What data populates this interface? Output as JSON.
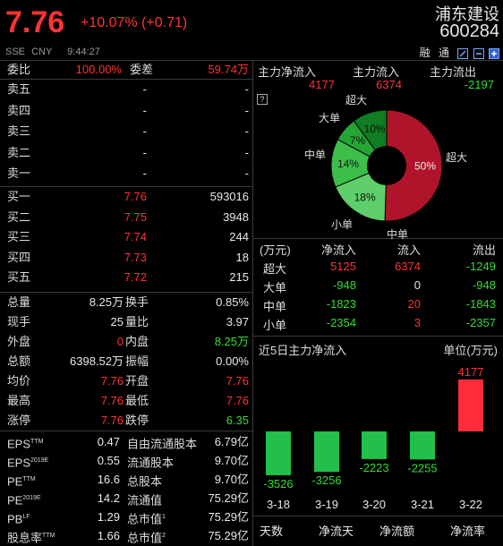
{
  "header": {
    "price": "7.76",
    "change": "+10.07% (+0.71)",
    "exchange": "SSE",
    "currency": "CNY",
    "time": "9:44:27",
    "stock_name": "浦东建设",
    "stock_code": "600284",
    "margin_label": "融",
    "through_label": "通"
  },
  "order_book": {
    "weibi_label": "委比",
    "weibi_value": "100.00%",
    "weicha_label": "委差",
    "weicha_value": "59.74万",
    "asks": [
      {
        "label": "卖五",
        "price": "-",
        "volume": "-"
      },
      {
        "label": "卖四",
        "price": "-",
        "volume": "-"
      },
      {
        "label": "卖三",
        "price": "-",
        "volume": "-"
      },
      {
        "label": "卖二",
        "price": "-",
        "volume": "-"
      },
      {
        "label": "卖一",
        "price": "-",
        "volume": "-"
      }
    ],
    "bids": [
      {
        "label": "买一",
        "price": "7.76",
        "volume": "593016"
      },
      {
        "label": "买二",
        "price": "7.75",
        "volume": "3948"
      },
      {
        "label": "买三",
        "price": "7.74",
        "volume": "244"
      },
      {
        "label": "买四",
        "price": "7.73",
        "volume": "18"
      },
      {
        "label": "买五",
        "price": "7.72",
        "volume": "215"
      }
    ]
  },
  "stats": [
    {
      "l1": "总量",
      "v1": "8.25万",
      "l2": "换手",
      "v2": "0.85%",
      "c1": "white",
      "c2": "white"
    },
    {
      "l1": "现手",
      "v1": "25",
      "l2": "量比",
      "v2": "3.97",
      "c1": "white",
      "c2": "white"
    },
    {
      "l1": "外盘",
      "v1": "0",
      "l2": "内盘",
      "v2": "8.25万",
      "c1": "red",
      "c2": "green"
    },
    {
      "l1": "总额",
      "v1": "6398.52万",
      "l2": "振幅",
      "v2": "0.00%",
      "c1": "white",
      "c2": "white"
    },
    {
      "l1": "均价",
      "v1": "7.76",
      "l2": "开盘",
      "v2": "7.76",
      "c1": "red",
      "c2": "red"
    },
    {
      "l1": "最高",
      "v1": "7.76",
      "l2": "最低",
      "v2": "7.76",
      "c1": "red",
      "c2": "red"
    },
    {
      "l1": "涨停",
      "v1": "7.76",
      "l2": "跌停",
      "v2": "6.35",
      "c1": "red",
      "c2": "green"
    }
  ],
  "fundamentals": [
    {
      "l1": "EPS",
      "s1": "TTM",
      "v1": "0.47",
      "l2": "自由流通股本",
      "s2": "",
      "v2": "6.79亿"
    },
    {
      "l1": "EPS",
      "s1": "2019E",
      "v1": "0.55",
      "l2": "流通股本",
      "s2": "",
      "v2": "9.70亿"
    },
    {
      "l1": "PE",
      "s1": "TTM",
      "v1": "16.6",
      "l2": "总股本",
      "s2": "",
      "v2": "9.70亿"
    },
    {
      "l1": "PE",
      "s1": "2019E",
      "v1": "14.2",
      "l2": "流通值",
      "s2": "",
      "v2": "75.29亿"
    },
    {
      "l1": "PB",
      "s1": "LF",
      "v1": "1.29",
      "l2": "总市值",
      "s2": "1",
      "v2": "75.29亿"
    },
    {
      "l1": "股息率",
      "s1": "TTM",
      "v1": "1.66",
      "l2": "总市值",
      "s2": "2",
      "v2": "75.29亿"
    }
  ],
  "capital_flow": {
    "net_in_label": "主力净流入",
    "in_label": "主力流入",
    "out_label": "主力流出",
    "net_in_value": "4177",
    "in_value": "6374",
    "out_value": "-2197",
    "help_label": "?"
  },
  "pie": {
    "labels": {
      "super": "超大",
      "large": "大单",
      "medium": "中单",
      "small": "小单"
    },
    "slices": [
      {
        "name": "超大",
        "pct": 50,
        "label": "50%",
        "color": "#b0142a"
      },
      {
        "name": "小单",
        "pct": 18,
        "label": "18%",
        "color": "#5ecf6a"
      },
      {
        "name": "中单",
        "pct": 14,
        "label": "14%",
        "color": "#3cbf4a"
      },
      {
        "name": "大单",
        "pct": 7,
        "label": "7%",
        "color": "#24a634"
      },
      {
        "name": "超大",
        "pct": 10,
        "label": "10%",
        "color": "#0f7e22"
      }
    ],
    "top_label": "超大",
    "left_top_label": "大单",
    "left_label": "中单",
    "bottom_label": "小单",
    "bottom_cut_label": "中单",
    "right_label": "超大"
  },
  "flow_table": {
    "headers": [
      "(万元)",
      "净流入",
      "流入",
      "流出"
    ],
    "rows": [
      {
        "name": "超大",
        "net": "5125",
        "in": "6374",
        "out": "-1249",
        "cn": "red",
        "ci": "red",
        "co": "green"
      },
      {
        "name": "大单",
        "net": "-948",
        "in": "0",
        "out": "-948",
        "cn": "green",
        "ci": "white",
        "co": "green"
      },
      {
        "name": "中单",
        "net": "-1823",
        "in": "20",
        "out": "-1843",
        "cn": "green",
        "ci": "red",
        "co": "green"
      },
      {
        "name": "小单",
        "net": "-2354",
        "in": "3",
        "out": "-2357",
        "cn": "green",
        "ci": "red",
        "co": "green"
      }
    ]
  },
  "chart_data": {
    "type": "bar",
    "title": "近5日主力净流入",
    "unit_label": "单位(万元)",
    "categories": [
      "3-18",
      "3-19",
      "3-20",
      "3-21",
      "3-22"
    ],
    "values": [
      -3526,
      -3256,
      -2223,
      -2255,
      4177
    ],
    "value_labels": [
      "-3526",
      "-3256",
      "-2223",
      "-2255",
      "4177"
    ],
    "pos_color": "#ff2d3a",
    "neg_color": "#22c04a"
  },
  "bottom_tabs": [
    "天数",
    "净流天",
    "净流额",
    "净流率"
  ]
}
